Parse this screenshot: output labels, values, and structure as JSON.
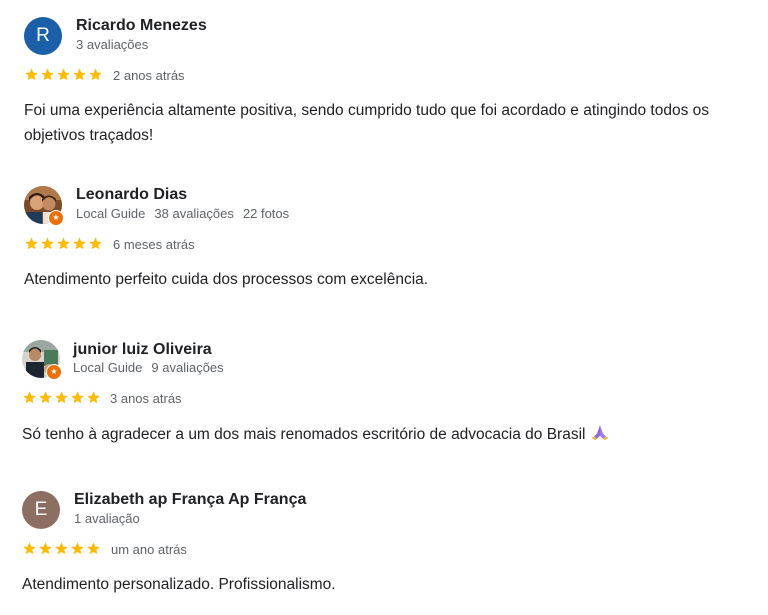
{
  "colors": {
    "star": "#fbbc04",
    "avatar_r": "#1a5fa8",
    "avatar_e": "#8d6e63",
    "badge": "#e8710a"
  },
  "reviews": [
    {
      "avatar_letter": "R",
      "avatar_type": "letter",
      "name": "Ricardo Menezes",
      "guide_label": "",
      "reviews_count": "3 avaliações",
      "photos_count": "",
      "rating": 5,
      "time": "2 anos atrás",
      "text": "Foi uma experiência altamente positiva, sendo cumprido tudo que foi acordado e atingindo todos os objetivos traçados!"
    },
    {
      "avatar_letter": "",
      "avatar_type": "photo",
      "name": "Leonardo Dias",
      "guide_label": "Local Guide",
      "reviews_count": "38 avaliações",
      "photos_count": "22 fotos",
      "rating": 5,
      "time": "6 meses atrás",
      "text": "Atendimento perfeito cuida dos processos com excelência."
    },
    {
      "avatar_letter": "",
      "avatar_type": "photo",
      "name": "junior luiz Oliveira",
      "guide_label": "Local Guide",
      "reviews_count": "9 avaliações",
      "photos_count": "",
      "rating": 5,
      "time": "3 anos atrás",
      "text": "Só tenho à agradecer a um dos mais renomados escritório de advocacia do Brasil",
      "emoji": "folded-hands-emoji"
    },
    {
      "avatar_letter": "E",
      "avatar_type": "letter",
      "name": "Elizabeth ap França Ap França",
      "guide_label": "",
      "reviews_count": "1 avaliação",
      "photos_count": "",
      "rating": 5,
      "time": "um ano atrás",
      "text": "Atendimento personalizado. Profissionalismo."
    }
  ]
}
